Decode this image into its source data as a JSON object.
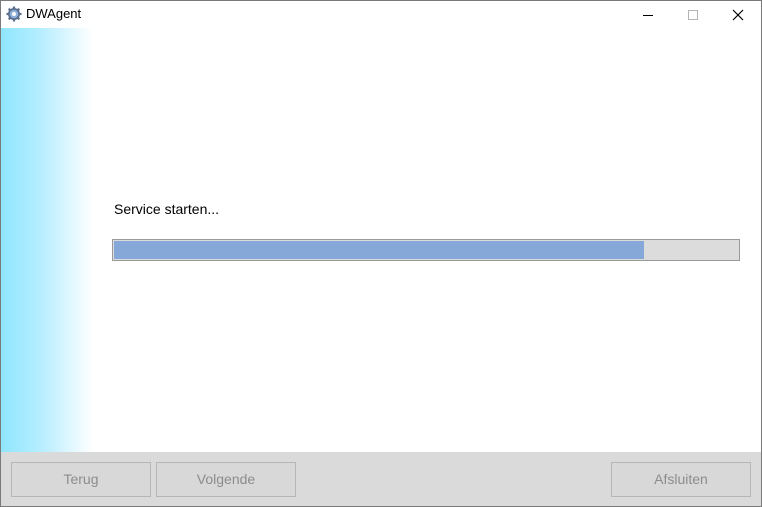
{
  "window": {
    "title": "DWAgent",
    "icon": "gear-icon"
  },
  "status": {
    "message": "Service starten...",
    "progress_fraction": 0.85
  },
  "footer": {
    "back_label": "Terug",
    "next_label": "Volgende",
    "finish_label": "Afsluiten"
  },
  "colors": {
    "progress_fill": "#86a8d8",
    "progress_track": "#dcdcdc",
    "side_gradient_start": "#8fe6ff",
    "footer_bg": "#dadada",
    "disabled_text": "#8c8c8c"
  }
}
